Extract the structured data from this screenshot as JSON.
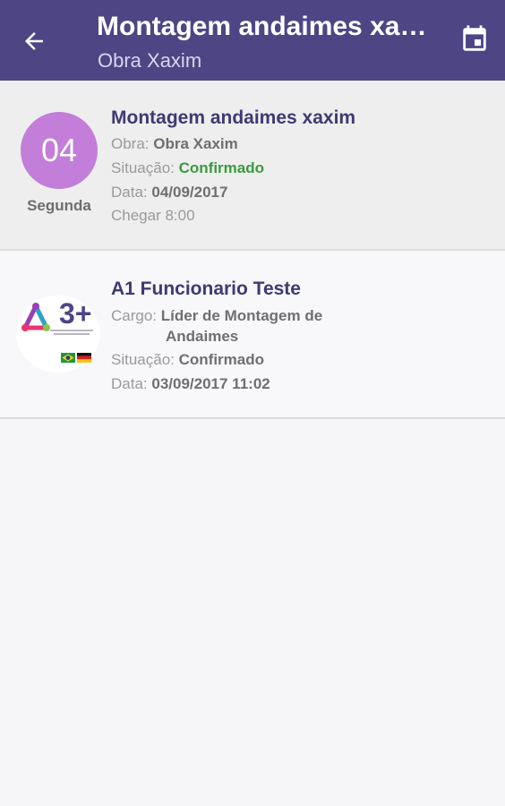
{
  "appbar": {
    "title": "Montagem andaimes xaxim",
    "subtitle": "Obra Xaxim",
    "back_icon": "arrow-back-icon",
    "calendar_icon": "calendar-icon",
    "color": "#4e4585"
  },
  "event_card": {
    "day": "04",
    "weekday": "Segunda",
    "title": "Montagem andaimes xaxim",
    "obra_label": "Obra:",
    "obra_value": "Obra Xaxim",
    "situacao_label": "Situação:",
    "situacao_value": "Confirmado",
    "data_label": "Data:",
    "data_value": "04/09/2017",
    "chegar": "Chegar 8:00",
    "circle_color": "#c27ed8",
    "status_color": "#3c9a3e"
  },
  "employee_card": {
    "logo_text": "3+",
    "title": "A1 Funcionario Teste",
    "cargo_label": "Cargo:",
    "cargo_value_line1": "Líder de Montagem de",
    "cargo_value_line2": "Andaimes",
    "situacao_label": "Situação:",
    "situacao_value": "Confirmado",
    "data_label": "Data:",
    "data_value": "03/09/2017 11:02"
  }
}
